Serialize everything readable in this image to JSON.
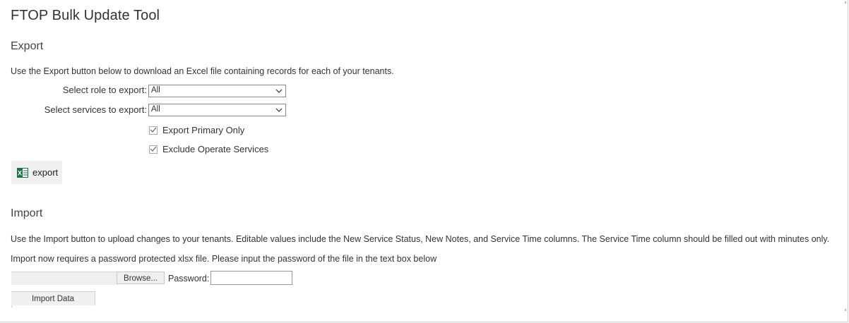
{
  "app": {
    "title": "FTOP Bulk Update Tool"
  },
  "export": {
    "heading": "Export",
    "description": "Use the Export button below to download an Excel file containing records for each of your tenants.",
    "role_label": "Select role to export:",
    "role_value": "All",
    "services_label": "Select services to export:",
    "services_value": "All",
    "checkboxes": [
      {
        "label": "Export Primary Only",
        "checked": true
      },
      {
        "label": "Exclude Operate Services",
        "checked": true
      }
    ],
    "button_label": "export",
    "button_icon": "excel-icon"
  },
  "import": {
    "heading": "Import",
    "description1": "Use the Import button to upload changes to your tenants. Editable values include the New Service Status, New Notes, and Service Time columns. The Service Time column should be filled out with minutes only.",
    "description2": "Import now requires a password protected xlsx file. Please input the password of the file in the text box below",
    "browse_label": "Browse...",
    "password_label": "Password:",
    "password_value": "",
    "button_label": "Import Data"
  },
  "colors": {
    "excel_green": "#1e7145",
    "border": "#888888",
    "button_bg": "#f0f0f0"
  }
}
